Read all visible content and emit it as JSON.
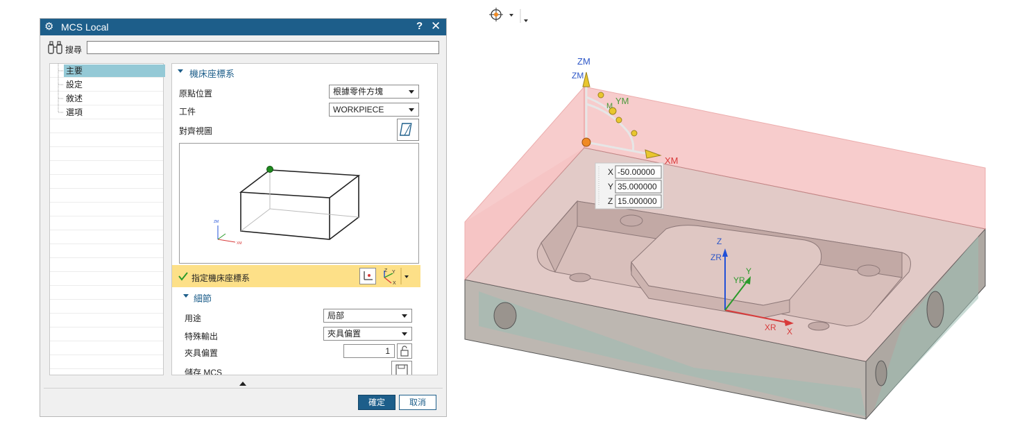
{
  "dialog": {
    "title": "MCS Local",
    "help_label": "?",
    "close_label": "✕",
    "search_label": "搜尋",
    "search_value": "",
    "tree": [
      "主要",
      "設定",
      "敘述",
      "選項"
    ],
    "sections": {
      "machine_csys": "機床座標系",
      "details": "細節"
    },
    "fields": {
      "origin_label": "原點位置",
      "origin_value": "根據零件方塊",
      "workpiece_label": "工件",
      "workpiece_value": "WORKPIECE",
      "align_view_label": "對齊視圖",
      "specify_csys_label": "指定機床座標系",
      "purpose_label": "用途",
      "purpose_value": "局部",
      "special_output_label": "特殊輸出",
      "special_output_value": "夾具偏置",
      "fixture_offset_label": "夾具偏置",
      "fixture_offset_value": "1",
      "save_mcs_label": "儲存 MCS"
    },
    "preview_axes": {
      "zm": "ZM",
      "xm": "XM",
      "ym": "YM"
    },
    "ok_label": "確定",
    "cancel_label": "取消"
  },
  "viewport": {
    "labels": {
      "zm1": "ZM",
      "zm2": "ZM",
      "ym1": "YM",
      "ym2": "M",
      "xm": "XM",
      "z": "Z",
      "zr": "ZR",
      "y": "Y",
      "yr": "YR",
      "x": "X",
      "xr": "XR"
    },
    "coords": {
      "x_label": "X",
      "x_value": "-50.00000",
      "y_label": "Y",
      "y_value": "35.000000",
      "z_label": "Z",
      "z_value": "15.000000"
    }
  },
  "colors": {
    "title_bar": "#1d5e8a",
    "highlight_row": "#fde088",
    "tree_selection": "#94c9d6",
    "part_face": "#d9d4cf",
    "part_side": "#bdb7b1",
    "clip_plane": "#f4b7b7"
  }
}
